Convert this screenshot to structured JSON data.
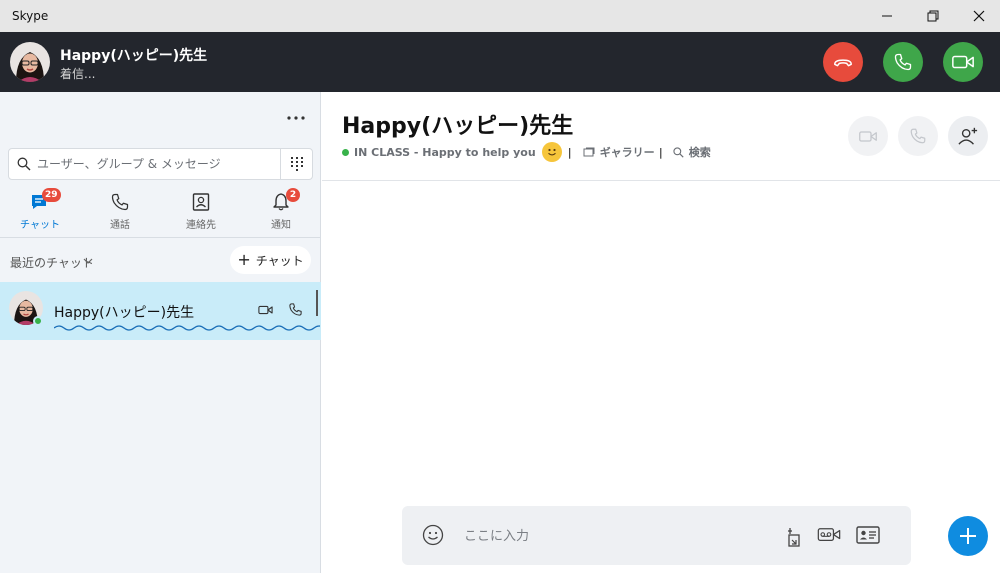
{
  "window": {
    "title": "Skype",
    "controls": [
      "minimize-icon",
      "restore-icon",
      "close-icon"
    ]
  },
  "incoming_call": {
    "caller_name": "Happy(ハッピー)先生",
    "status": "着信...",
    "buttons": [
      {
        "name": "decline",
        "icon": "hang-up-icon",
        "color": "#e74b3c"
      },
      {
        "name": "answer-audio",
        "icon": "phone-icon",
        "color": "#3fa64a"
      },
      {
        "name": "answer-video",
        "icon": "video-camera-icon",
        "color": "#3fa64a"
      }
    ]
  },
  "sidebar": {
    "search_placeholder": "ユーザー、グループ & メッセージ",
    "tabs": [
      {
        "label": "チャット",
        "icon": "chat-icon",
        "badge": "29",
        "active": true
      },
      {
        "label": "通話",
        "icon": "phone-icon",
        "badge": null,
        "active": false
      },
      {
        "label": "連絡先",
        "icon": "contacts-icon",
        "badge": null,
        "active": false
      },
      {
        "label": "通知",
        "icon": "bell-icon",
        "badge": "2",
        "active": false
      }
    ],
    "recent_label": "最近のチャット",
    "new_chat_label": "チャット",
    "chats": [
      {
        "name": "Happy(ハッピー)先生",
        "online": true,
        "selected": true
      }
    ]
  },
  "conversation": {
    "title": "Happy(ハッピー)先生",
    "status_text": "IN CLASS - Happy to help you",
    "gallery_label": "ギャラリー",
    "search_label": "検索",
    "header_buttons": [
      "video-call-icon",
      "audio-call-icon",
      "add-person-icon"
    ]
  },
  "composer": {
    "placeholder": "ここに入力",
    "icons": [
      "emoji-icon",
      "file-share-icon",
      "video-message-icon",
      "contact-card-icon"
    ],
    "fab_icon": "plus-icon"
  },
  "colors": {
    "accent": "#0078d4",
    "call_bar": "#23262d",
    "decline": "#e74b3c",
    "answer": "#3fa64a",
    "selected_chat": "#c9ecf9",
    "online": "#38b24a",
    "badge": "#e74b3c",
    "fab": "#0f8ce0"
  }
}
